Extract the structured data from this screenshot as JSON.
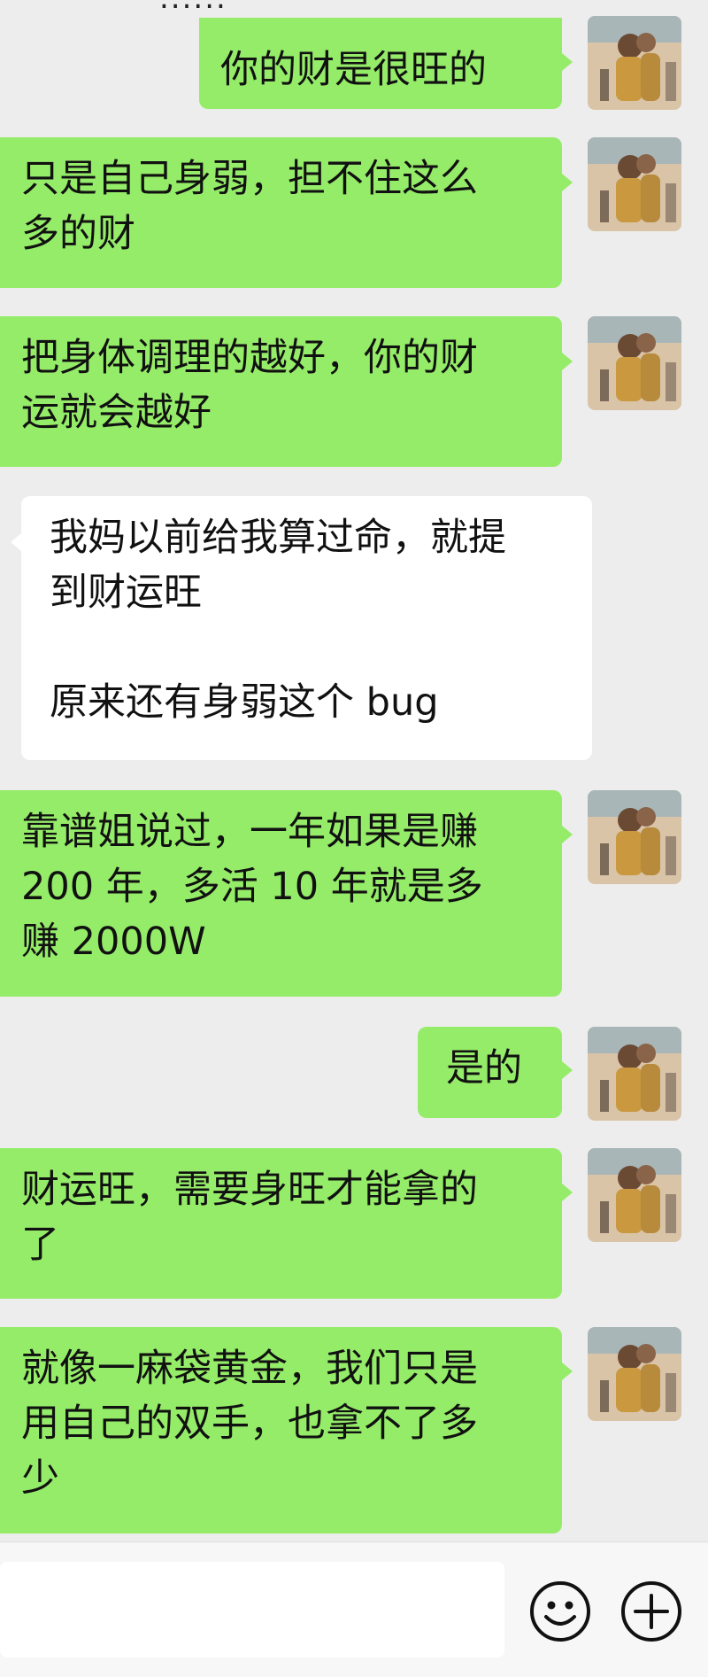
{
  "header": {
    "title_fragment": "......"
  },
  "messages": [
    {
      "side": "sent",
      "text": "你的财是很旺的"
    },
    {
      "side": "sent",
      "text": "只是自己身弱，担不住这么\n多的财"
    },
    {
      "side": "sent",
      "text": "把身体调理的越好，你的财\n运就会越好"
    },
    {
      "side": "recv",
      "text": "我妈以前给我算过命，就提\n到财运旺\n\n原来还有身弱这个 bug"
    },
    {
      "side": "sent",
      "text": "靠谱姐说过，一年如果是赚\n200 年，多活 10 年就是多\n赚 2000W"
    },
    {
      "side": "sent",
      "text": "是的"
    },
    {
      "side": "sent",
      "text": "财运旺，需要身旺才能拿的\n了"
    },
    {
      "side": "sent",
      "text": "就像一麻袋黄金，我们只是\n用自己的双手，也拿不了多\n少"
    }
  ],
  "input_bar": {
    "emoji_icon": "smiley-face-icon",
    "plus_icon": "plus-circle-icon"
  },
  "colors": {
    "sent_bubble": "#95ec69",
    "recv_bubble": "#ffffff",
    "background": "#ededed"
  }
}
